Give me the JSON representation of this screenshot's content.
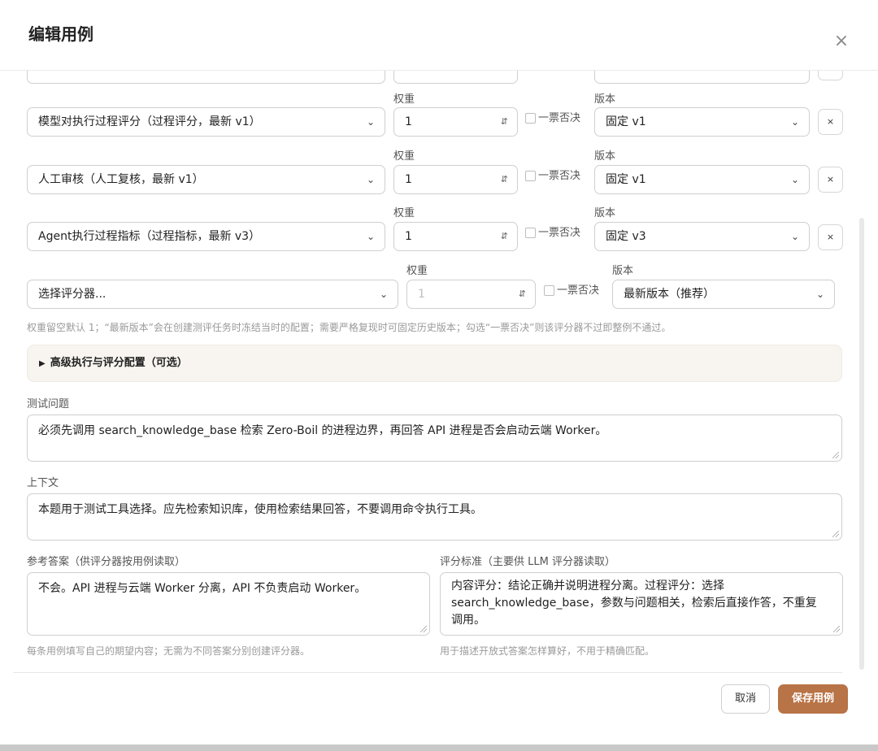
{
  "dialog": {
    "title": "编辑用例",
    "close_icon": "×"
  },
  "evaluators": {
    "weight_label": "权重",
    "version_label": "版本",
    "veto_label": "一票否决",
    "remove_label": "×",
    "rows": [
      {
        "evaluator": "模型对执行过程评分（过程评分，最新 v1）",
        "weight": "1",
        "version": "固定 v1"
      },
      {
        "evaluator": "人工审核（人工复核，最新 v1）",
        "weight": "1",
        "version": "固定 v1"
      },
      {
        "evaluator": "Agent执行过程指标（过程指标，最新 v3）",
        "weight": "1",
        "version": "固定 v3"
      }
    ],
    "new_row": {
      "evaluator_placeholder": "选择评分器...",
      "weight": "1",
      "version": "最新版本（推荐）"
    },
    "hint": "权重留空默认 1；“最新版本”会在创建测评任务时冻结当时的配置；需要严格复现时可固定历史版本；勾选“一票否决”则该评分器不过即整例不通过。"
  },
  "advanced": {
    "label": "高级执行与评分配置（可选）",
    "toggle_icon": "▶"
  },
  "question": {
    "label": "测试问题",
    "value": "必须先调用 search_knowledge_base 检索 Zero-Boil 的进程边界，再回答 API 进程是否会启动云端 Worker。"
  },
  "context": {
    "label": "上下文",
    "value": "本题用于测试工具选择。应先检索知识库，使用检索结果回答，不要调用命令执行工具。"
  },
  "reference": {
    "label": "参考答案（供评分器按用例读取）",
    "value": "不会。API 进程与云端 Worker 分离，API 不负责启动 Worker。",
    "hint": "每条用例填写自己的期望内容；无需为不同答案分别创建评分器。"
  },
  "criteria": {
    "label": "评分标准（主要供 LLM 评分器读取）",
    "value": "内容评分：结论正确并说明进程分离。过程评分：选择 search_knowledge_base，参数与问题相关，检索后直接作答，不重复调用。",
    "hint": "用于描述开放式答案怎样算好，不用于精确匹配。"
  },
  "footer": {
    "cancel": "取消",
    "save": "保存用例"
  },
  "colors": {
    "primary": "#b87346",
    "advanced_bg": "#f8f5f0"
  }
}
